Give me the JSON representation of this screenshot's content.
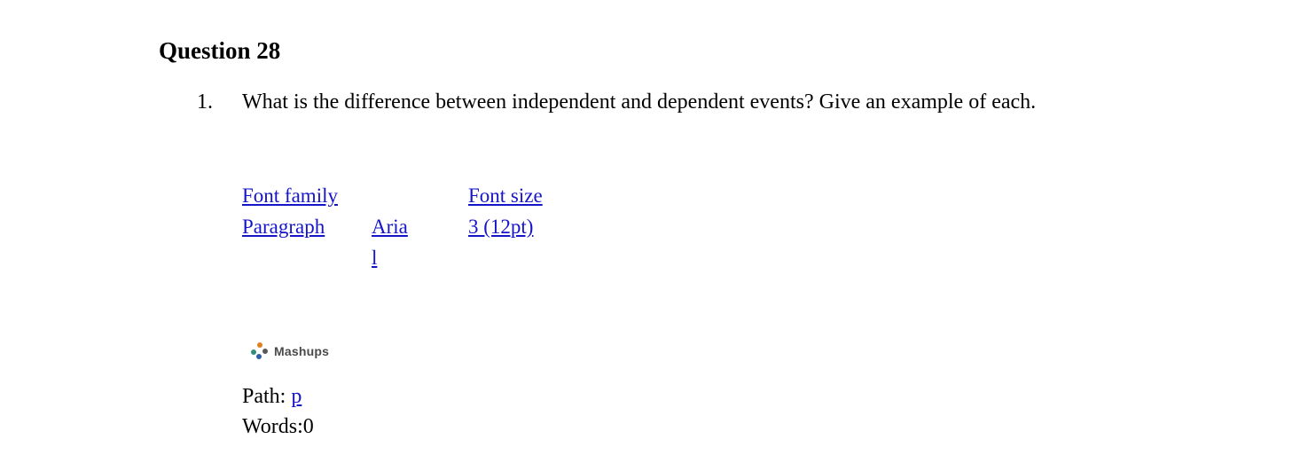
{
  "heading": {
    "title": "Question 28"
  },
  "question": {
    "marker": "1.",
    "text": "What is the difference between independent and dependent events? Give an example of each."
  },
  "editor_toolbar": {
    "rows": [
      {
        "col1": "Font family",
        "col2": "",
        "col3": "Font size"
      },
      {
        "col1": "Paragraph",
        "col2": "Arial",
        "col3": "3 (12pt)"
      }
    ],
    "link_color": "#1414c8"
  },
  "mashups": {
    "label": "Mashups",
    "icon": "mashups-dots-icon",
    "dot_colors": {
      "top": "#e08020",
      "left": "#2f8f7a",
      "right": "#5a5a5a",
      "bottom": "#2f5fa8"
    }
  },
  "status": {
    "path_label": "Path:",
    "path_value": "p",
    "words_label": "Words:0"
  }
}
